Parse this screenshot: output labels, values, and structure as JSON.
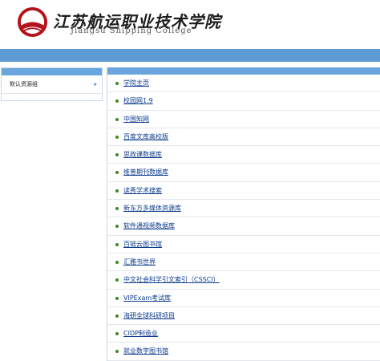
{
  "header": {
    "logo_emblem_text": "江苏航运职业技术学院",
    "title_cn": "江苏航运职业技术学院",
    "title_en": "Jiangsu Shipping College"
  },
  "sidebar": {
    "items": [
      {
        "label": "默认资源组",
        "icon": "chevron-right-icon"
      }
    ]
  },
  "databases": [
    "学院主页",
    "校园网1.9",
    "中国知网",
    "百度文库高校版",
    "思政课数据库",
    "维普期刊数据库",
    "读秀学术搜索",
    "新东方多媒体资源库",
    "软件通视频数据库",
    "百链云图书馆",
    "汇雅书世界",
    "中文社会科学引文索引（CSSCI）",
    "VIPExam考试库",
    "海研全球科研项目",
    "CIDP制造业",
    "就业数字图书馆"
  ],
  "colors": {
    "accent": "#5d9bd6",
    "panel_header": "#6aa6de",
    "link": "#0b3a8c",
    "bullet": "#3a8a1f",
    "emblem": "#b5121b"
  }
}
